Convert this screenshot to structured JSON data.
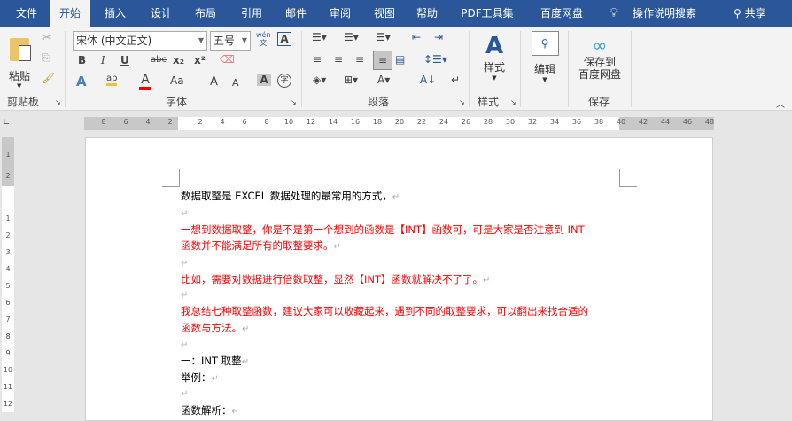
{
  "tabs": [
    "文件",
    "开始",
    "插入",
    "设计",
    "布局",
    "引用",
    "邮件",
    "审阅",
    "视图",
    "帮助",
    "PDF工具集",
    "百度网盘"
  ],
  "search": "操作说明搜索",
  "share": "共享",
  "clipboard": {
    "paste": "粘贴",
    "label": "剪贴板"
  },
  "font": {
    "name": "宋体 (中文正文)",
    "size": "五号",
    "label": "字体",
    "phonetic": "wén\n文",
    "bold": "B",
    "italic": "I",
    "underline": "U",
    "strike": "abc",
    "sub": "x₂",
    "sup": "x²",
    "case": "Aa",
    "grow": "A",
    "shrink": "A",
    "shade": "A",
    "enclose": "字"
  },
  "paragraph": {
    "label": "段落"
  },
  "styles": {
    "button": "样式",
    "label": "样式"
  },
  "editing": {
    "button": "编辑"
  },
  "save": {
    "button_line1": "保存到",
    "button_line2": "百度网盘",
    "label": "保存"
  },
  "ruler": {
    "h": [
      "8",
      "6",
      "4",
      "2",
      "2",
      "4",
      "6",
      "8",
      "10",
      "12",
      "14",
      "16",
      "18",
      "20",
      "22",
      "24",
      "26",
      "28",
      "30",
      "32",
      "34",
      "36",
      "38",
      "40",
      "42",
      "44",
      "46",
      "48"
    ],
    "v": [
      "1",
      "2",
      "1",
      "2",
      "3",
      "4",
      "5",
      "6",
      "7",
      "8",
      "9",
      "10",
      "11",
      "12"
    ]
  },
  "document": {
    "lines": [
      {
        "text": "数据取整是 EXCEL 数据处理的最常用的方式，",
        "red": false
      },
      {
        "text": "",
        "red": false
      },
      {
        "text": "一想到数据取整，你是不是第一个想到的函数是【INT】函数可，可是大家是否注意到 INT",
        "red": true,
        "nomark": true
      },
      {
        "text": "函数并不能满足所有的取整要求。",
        "red": true
      },
      {
        "text": "",
        "red": false
      },
      {
        "text": "比如，需要对数据进行倍数取整，显然【INT】函数就解决不了了。",
        "red": true
      },
      {
        "text": "",
        "red": false
      },
      {
        "text": "我总结七种取整函数，建议大家可以收藏起来，遇到不同的取整要求，可以翻出来找合适的",
        "red": true,
        "nomark": true
      },
      {
        "text": "函数与方法。",
        "red": true
      },
      {
        "text": "",
        "red": false
      },
      {
        "text": "一：INT 取整",
        "red": false
      },
      {
        "text": "举例：",
        "red": false
      },
      {
        "text": "",
        "red": false
      },
      {
        "text": "函数解析：",
        "red": false
      }
    ]
  },
  "paragraph_mark": "↵"
}
